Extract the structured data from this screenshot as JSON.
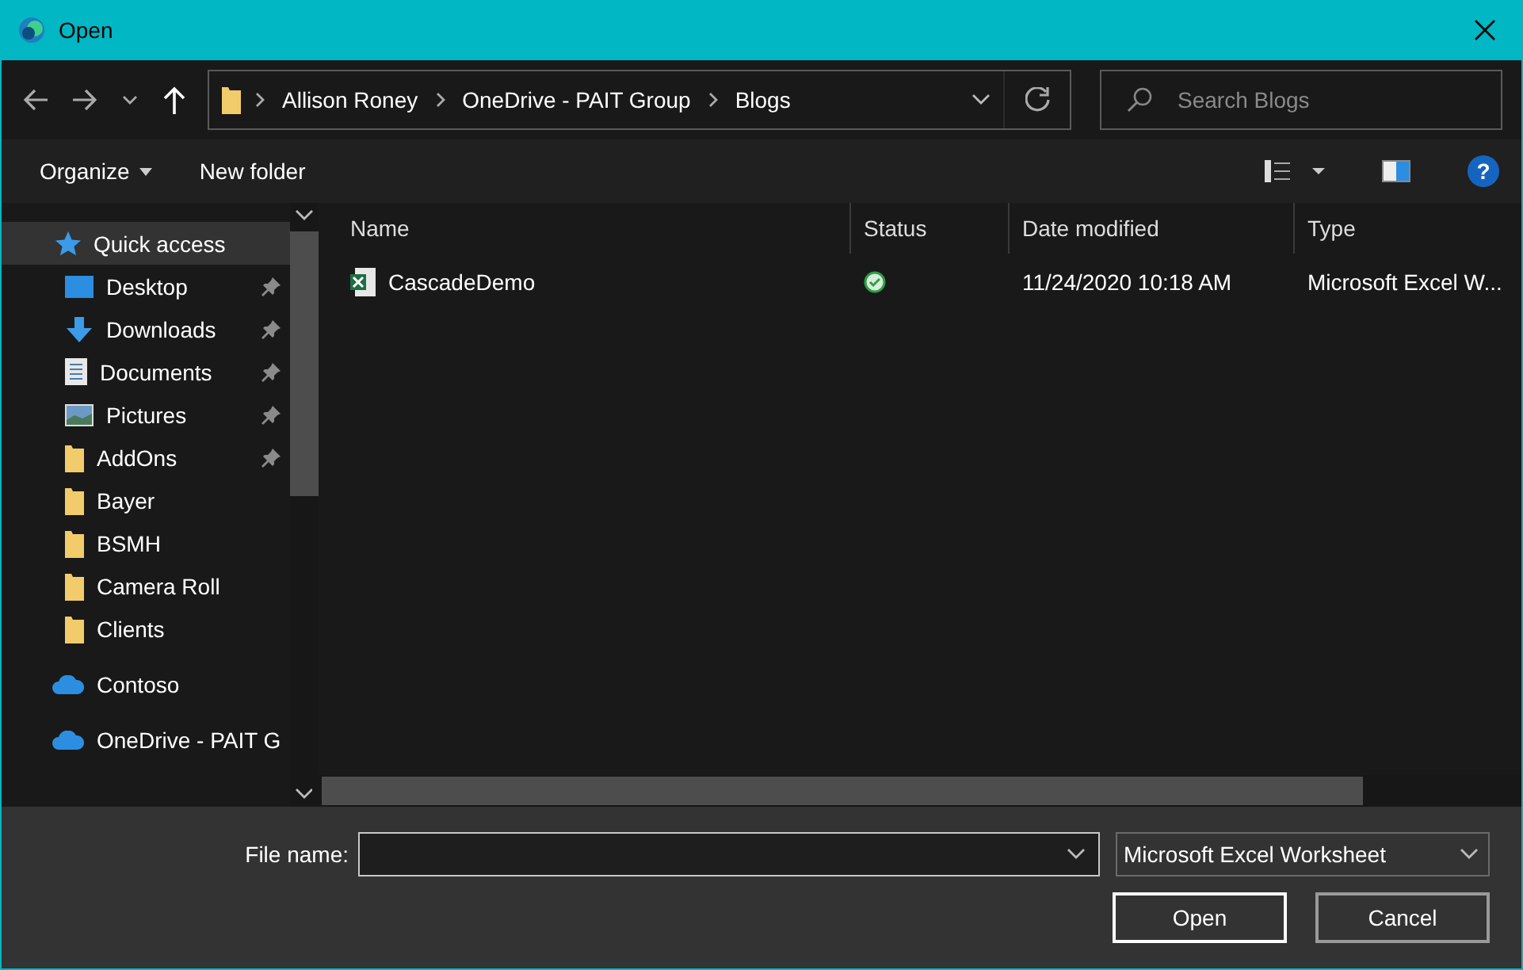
{
  "window": {
    "title": "Open"
  },
  "address": {
    "crumbs": [
      "Allison Roney",
      "OneDrive - PAIT Group",
      "Blogs"
    ]
  },
  "search": {
    "placeholder": "Search Blogs"
  },
  "toolbar": {
    "buttons": [
      {
        "label": "Organize",
        "kind": "menu"
      },
      {
        "label": "New folder",
        "kind": "plain"
      }
    ]
  },
  "sidebar": {
    "items": [
      {
        "label": "Quick access",
        "kind": "star",
        "pinned": false,
        "selected": true,
        "children": [
          {
            "label": "Desktop",
            "kind": "desktop",
            "pinned": true,
            "selected": false
          },
          {
            "label": "Downloads",
            "kind": "download",
            "pinned": true,
            "selected": false
          },
          {
            "label": "Documents",
            "kind": "document",
            "pinned": true,
            "selected": false
          },
          {
            "label": "Pictures",
            "kind": "picture",
            "pinned": true,
            "selected": false
          },
          {
            "label": "AddOns",
            "kind": "folder",
            "pinned": true,
            "selected": false
          },
          {
            "label": "Bayer",
            "kind": "folder",
            "pinned": false,
            "selected": false
          },
          {
            "label": "BSMH",
            "kind": "folder",
            "pinned": false,
            "selected": false
          },
          {
            "label": "Camera Roll",
            "kind": "folder",
            "pinned": false,
            "selected": false
          },
          {
            "label": "Clients",
            "kind": "folder",
            "pinned": false,
            "selected": false
          }
        ]
      },
      {
        "label": "Contoso",
        "kind": "cloud",
        "pinned": false,
        "selected": false
      },
      {
        "label": "OneDrive - PAIT G",
        "kind": "cloud",
        "pinned": false,
        "selected": false
      }
    ]
  },
  "table": {
    "columns": [
      "Name",
      "Status",
      "Date modified",
      "Type"
    ],
    "rows": [
      {
        "name": "CascadeDemo",
        "kind": "synced",
        "date": "11/24/2020 10:18 AM",
        "type": "Microsoft Excel W..."
      }
    ]
  },
  "help": {
    "label": "?"
  },
  "footer": {
    "file_name_label": "File name:",
    "file_type": "Microsoft Excel Worksheet",
    "buttons": [
      {
        "label": "Open",
        "kind": "primary"
      },
      {
        "label": "Cancel",
        "kind": "secondary"
      }
    ]
  }
}
